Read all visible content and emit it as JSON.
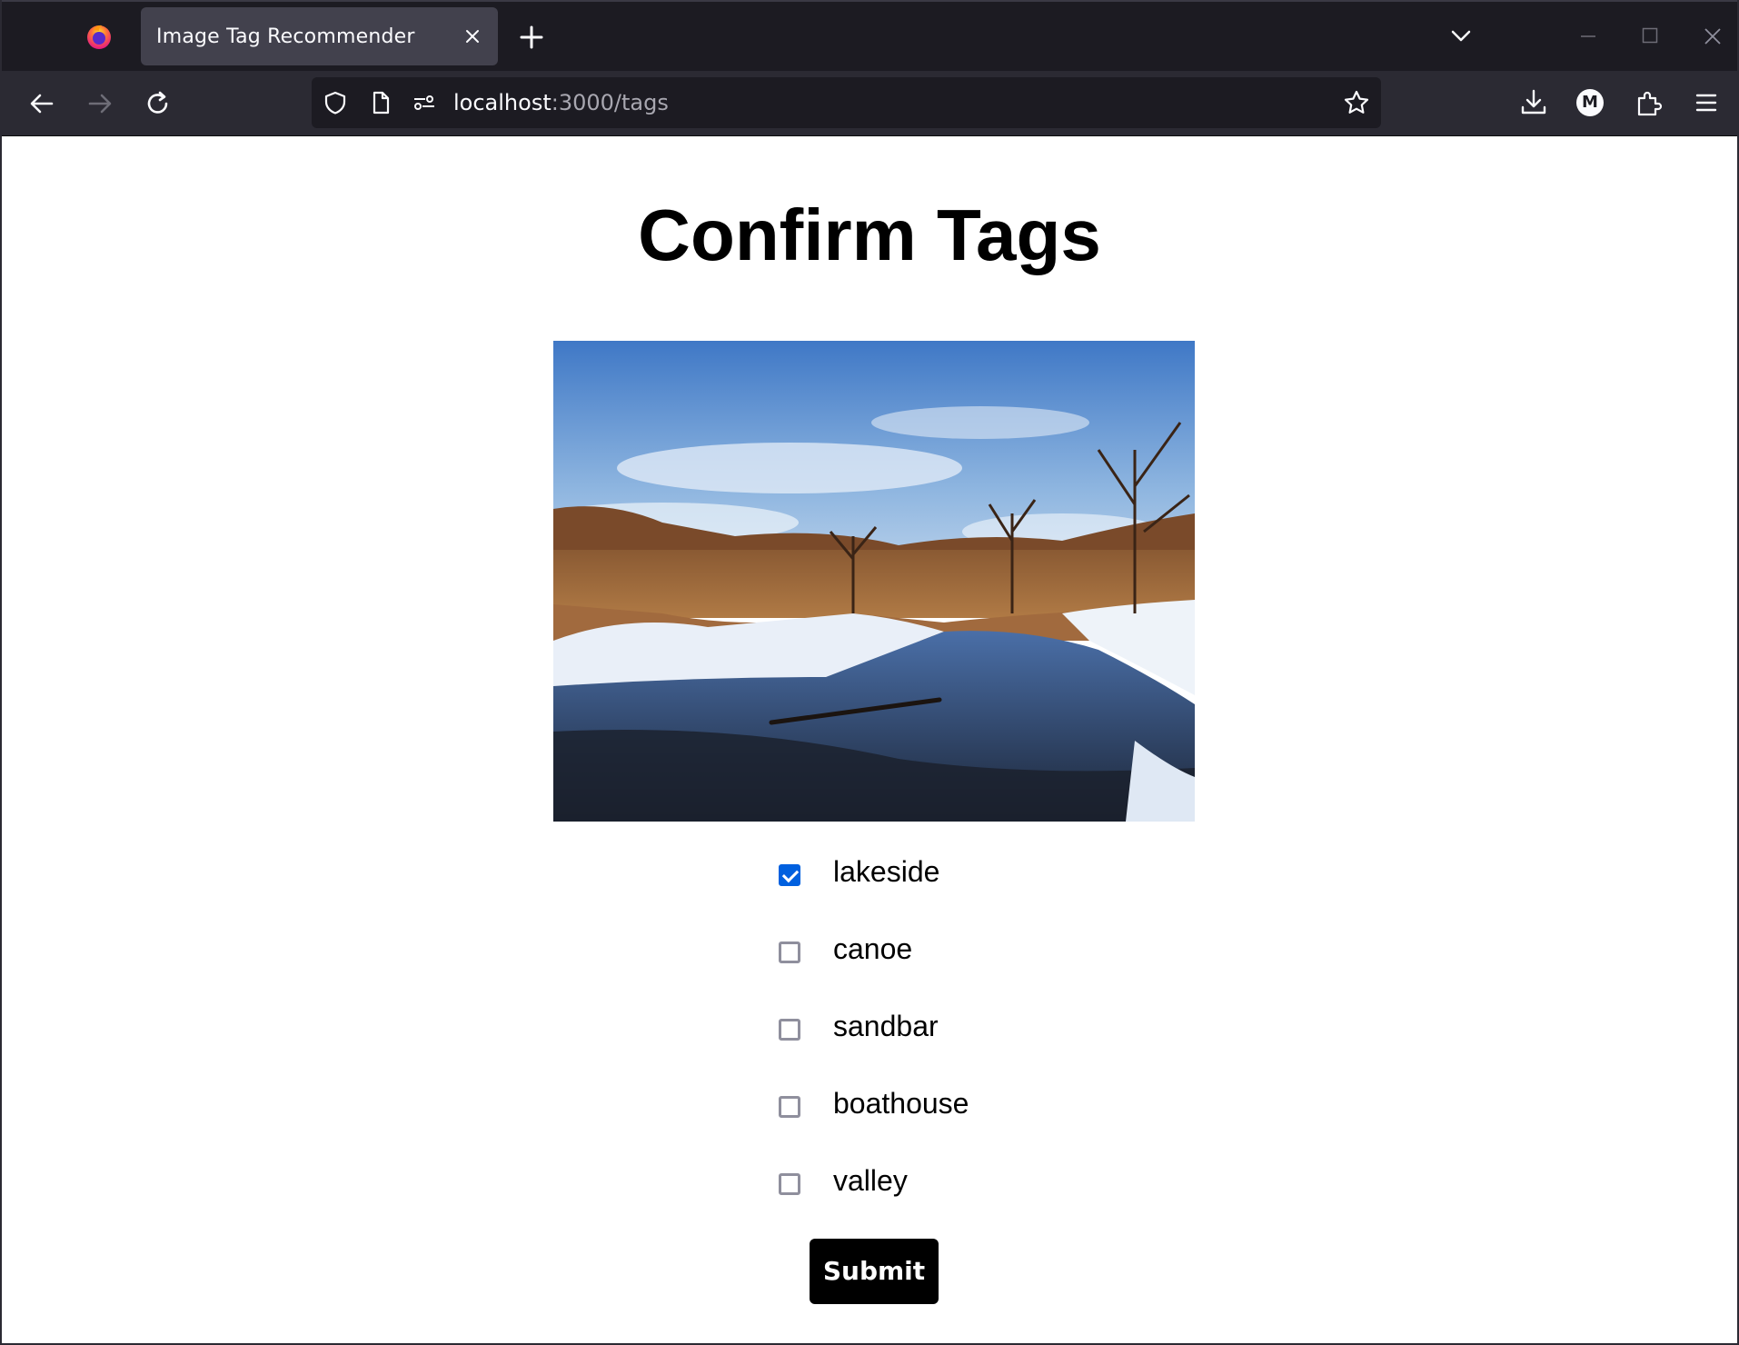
{
  "browser": {
    "tab_title": "Image Tag Recommender",
    "url_host": "localhost",
    "url_path": ":3000/tags",
    "profile_initial": "M"
  },
  "page": {
    "title": "Confirm Tags",
    "image_alt": "Snowy riverbank with reflections of trees under a blue sky",
    "tags": [
      {
        "label": "lakeside",
        "checked": true
      },
      {
        "label": "canoe",
        "checked": false
      },
      {
        "label": "sandbar",
        "checked": false
      },
      {
        "label": "boathouse",
        "checked": false
      },
      {
        "label": "valley",
        "checked": false
      }
    ],
    "submit_label": "Submit"
  },
  "colors": {
    "checkbox_checked": "#0060df",
    "submit_bg": "#000000",
    "chrome_dark": "#1c1b22"
  }
}
